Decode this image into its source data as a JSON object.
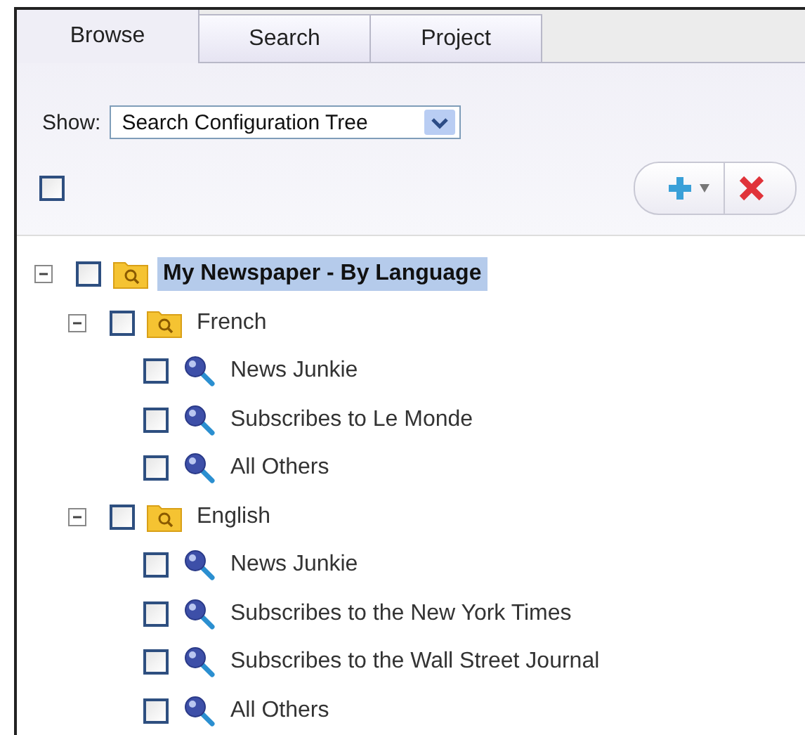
{
  "tabs": [
    {
      "label": "Browse",
      "selected": true
    },
    {
      "label": "Search",
      "selected": false
    },
    {
      "label": "Project",
      "selected": false
    }
  ],
  "show": {
    "label": "Show:",
    "value": "Search Configuration Tree"
  },
  "select_all": {
    "checked": false
  },
  "tree": [
    {
      "label": "My Newspaper - By Language",
      "kind": "folder",
      "expanded": true,
      "checked": false,
      "selected": true,
      "children": [
        {
          "label": "French",
          "kind": "folder",
          "expanded": true,
          "checked": false,
          "selected": false,
          "children": [
            {
              "label": "News Junkie",
              "kind": "search",
              "checked": false,
              "selected": false
            },
            {
              "label": "Subscribes to Le Monde",
              "kind": "search",
              "checked": false,
              "selected": false
            },
            {
              "label": "All Others",
              "kind": "search",
              "checked": false,
              "selected": false
            }
          ]
        },
        {
          "label": "English",
          "kind": "folder",
          "expanded": true,
          "checked": false,
          "selected": false,
          "children": [
            {
              "label": "News Junkie",
              "kind": "search",
              "checked": false,
              "selected": false
            },
            {
              "label": "Subscribes to the New York Times",
              "kind": "search",
              "checked": false,
              "selected": false
            },
            {
              "label": "Subscribes to the Wall Street Journal",
              "kind": "search",
              "checked": false,
              "selected": false
            },
            {
              "label": "All Others",
              "kind": "search",
              "checked": false,
              "selected": false
            }
          ]
        }
      ]
    }
  ]
}
